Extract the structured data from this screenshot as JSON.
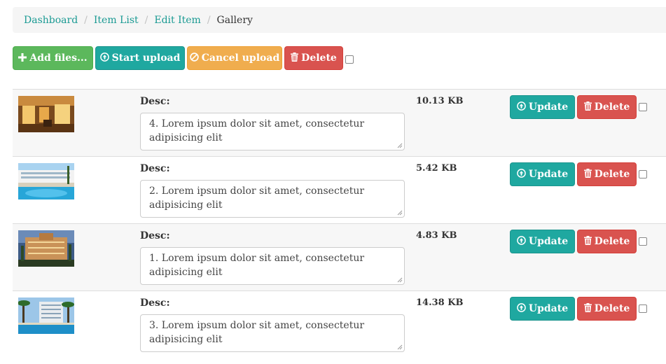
{
  "breadcrumb": {
    "items": [
      "Dashboard",
      "Item List",
      "Edit Item"
    ],
    "active": "Gallery",
    "separator": "/"
  },
  "toolbar": {
    "add_files": "Add files...",
    "start_upload": "Start upload",
    "cancel_upload": "Cancel upload",
    "delete": "Delete"
  },
  "icons": {
    "plus": "plus-icon",
    "upload": "circle-arrow-up-icon",
    "cancel": "ban-icon",
    "trash": "trash-icon"
  },
  "colors": {
    "success": "#5cb85c",
    "primary": "#1fa8a0",
    "warning": "#f0ad4e",
    "danger": "#d9534f",
    "link": "#1a9a93"
  },
  "files": [
    {
      "desc_label": "Desc:",
      "desc": "4. Lorem ipsum dolor sit amet, consectetur adipisicing elit",
      "size": "10.13 KB",
      "update": "Update",
      "delete": "Delete",
      "thumb": "lobby"
    },
    {
      "desc_label": "Desc:",
      "desc": "2. Lorem ipsum dolor sit amet, consectetur adipisicing elit",
      "size": "5.42 KB",
      "update": "Update",
      "delete": "Delete",
      "thumb": "pool"
    },
    {
      "desc_label": "Desc:",
      "desc": "1. Lorem ipsum dolor sit amet, consectetur adipisicing elit",
      "size": "4.83 KB",
      "update": "Update",
      "delete": "Delete",
      "thumb": "facade"
    },
    {
      "desc_label": "Desc:",
      "desc": "3. Lorem ipsum dolor sit amet, consectetur adipisicing elit",
      "size": "14.38 KB",
      "update": "Update",
      "delete": "Delete",
      "thumb": "palms"
    }
  ]
}
